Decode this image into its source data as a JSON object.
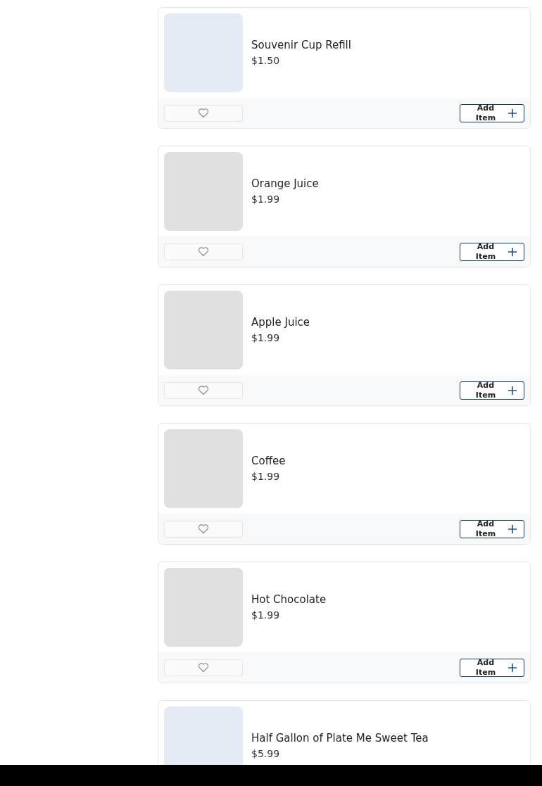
{
  "items": [
    {
      "name": "Souvenir Cup Refill",
      "price": "$1.50",
      "color": "#e5ebf5",
      "button": "Add Item"
    },
    {
      "name": "Orange Juice",
      "price": "$1.99",
      "color": "#e0e0e0",
      "button": "Add Item"
    },
    {
      "name": "Apple Juice",
      "price": "$1.99",
      "color": "#e0e0e0",
      "button": "Add Item"
    },
    {
      "name": "Coffee",
      "price": "$1.99",
      "color": "#e0e0e0",
      "button": "Add Item"
    },
    {
      "name": "Hot Chocolate",
      "price": "$1.99",
      "color": "#e0e0e0",
      "button": "Add Item"
    },
    {
      "name": "Half Gallon of Plate Me Sweet Tea",
      "price": "$5.99",
      "color": "#e5ebf5"
    }
  ]
}
